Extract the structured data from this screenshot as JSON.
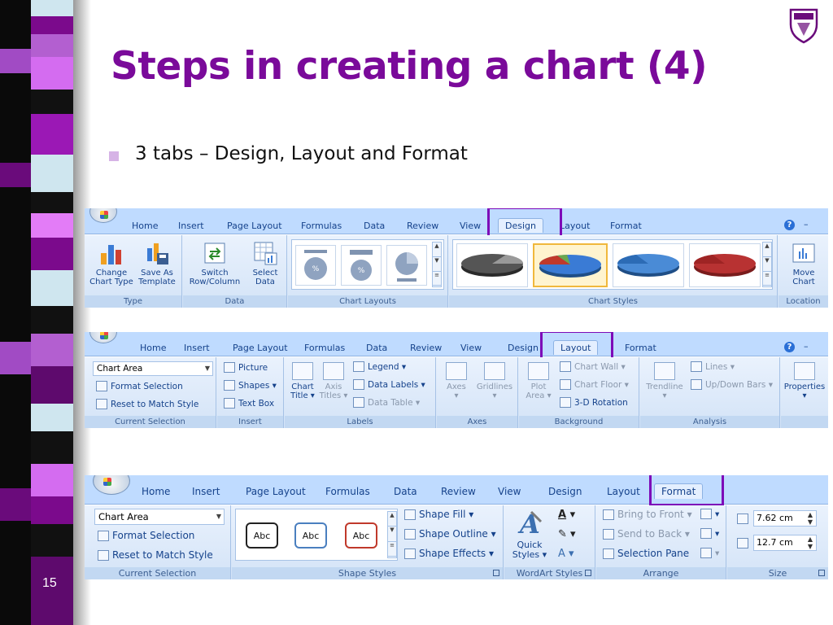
{
  "slide": {
    "title": "Steps in creating a chart (4)",
    "bullet": "3 tabs – Design, Layout and Format",
    "page_number": "15",
    "accent_color": "#7a0a9a",
    "highlight_color": "#7d0ab8"
  },
  "ribbon_design": {
    "tabs": [
      "Home",
      "Insert",
      "Page Layout",
      "Formulas",
      "Data",
      "Review",
      "View",
      "Design",
      "Layout",
      "Format"
    ],
    "active_tab": "Design",
    "help": "?",
    "minimize": "–",
    "groups": {
      "type": {
        "label": "Type",
        "change_chart_type": "Change\nChart Type",
        "save_as_template": "Save As\nTemplate"
      },
      "data": {
        "label": "Data",
        "switch_row_column": "Switch\nRow/Column",
        "select_data": "Select\nData"
      },
      "chart_layouts": {
        "label": "Chart Layouts"
      },
      "chart_styles": {
        "label": "Chart Styles"
      },
      "location": {
        "label": "Location",
        "move_chart": "Move\nChart"
      }
    }
  },
  "ribbon_layout": {
    "tabs": [
      "Home",
      "Insert",
      "Page Layout",
      "Formulas",
      "Data",
      "Review",
      "View",
      "Design",
      "Layout",
      "Format"
    ],
    "active_tab": "Layout",
    "help": "?",
    "minimize": "–",
    "groups": {
      "current_selection": {
        "label": "Current Selection",
        "selection_value": "Chart Area",
        "format_selection": "Format Selection",
        "reset_to_match_style": "Reset to Match Style"
      },
      "insert": {
        "label": "Insert",
        "picture": "Picture",
        "shapes": "Shapes ▾",
        "text_box": "Text Box"
      },
      "labels": {
        "label": "Labels",
        "chart_title": "Chart\nTitle ▾",
        "axis_titles": "Axis\nTitles ▾",
        "legend": "Legend ▾",
        "data_labels": "Data Labels ▾",
        "data_table": "Data Table ▾"
      },
      "axes": {
        "label": "Axes",
        "axes": "Axes\n▾",
        "gridlines": "Gridlines\n▾"
      },
      "background": {
        "label": "Background",
        "plot_area": "Plot\nArea ▾",
        "chart_wall": "Chart Wall ▾",
        "chart_floor": "Chart Floor ▾",
        "rotation_3d": "3-D Rotation"
      },
      "analysis": {
        "label": "Analysis",
        "trendline": "Trendline\n▾",
        "lines": "Lines ▾",
        "up_down_bars": "Up/Down Bars ▾"
      },
      "properties": {
        "label": "",
        "properties": "Properties\n▾"
      }
    }
  },
  "ribbon_format": {
    "tabs": [
      "Home",
      "Insert",
      "Page Layout",
      "Formulas",
      "Data",
      "Review",
      "View",
      "Design",
      "Layout",
      "Format"
    ],
    "active_tab": "Format",
    "groups": {
      "current_selection": {
        "label": "Current Selection",
        "selection_value": "Chart Area",
        "format_selection": "Format Selection",
        "reset_to_match_style": "Reset to Match Style"
      },
      "shape_styles": {
        "label": "Shape Styles",
        "swatch_text": "Abc",
        "shape_fill": "Shape Fill ▾",
        "shape_outline": "Shape Outline ▾",
        "shape_effects": "Shape Effects ▾"
      },
      "wordart_styles": {
        "label": "WordArt Styles",
        "quick_styles": "Quick\nStyles ▾"
      },
      "arrange": {
        "label": "Arrange",
        "bring_to_front": "Bring to Front ▾",
        "send_to_back": "Send to Back ▾",
        "selection_pane": "Selection Pane"
      },
      "size": {
        "label": "Size",
        "height": "7.62 cm",
        "width": "12.7 cm"
      }
    }
  }
}
